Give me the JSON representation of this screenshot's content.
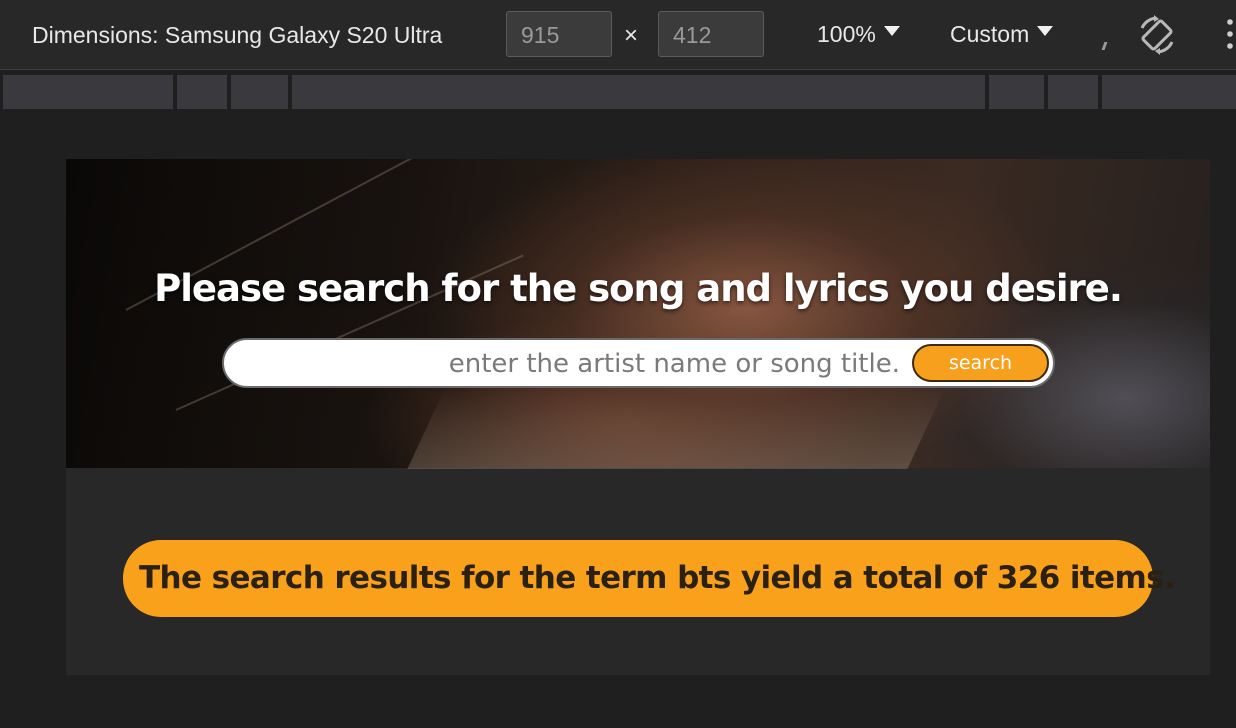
{
  "devtools": {
    "dimensions_label": "Dimensions: Samsung Galaxy S20 Ultra",
    "width_value": "915",
    "height_value": "412",
    "times_symbol": "×",
    "zoom_label": "100%",
    "throttle_label": "Custom",
    "icons": [
      "chevron-down-icon",
      "rotate-icon",
      "more-vertical-icon"
    ]
  },
  "page": {
    "hero_title": "Please search for the song and lyrics you desire.",
    "search_placeholder": "enter the artist name or song title.",
    "search_button_label": "search",
    "result_text": "The search results for the term bts yield a total of 326 items."
  },
  "colors": {
    "accent": "#f9a11b",
    "page_bg": "#282828",
    "devtools_bg": "#282828"
  }
}
